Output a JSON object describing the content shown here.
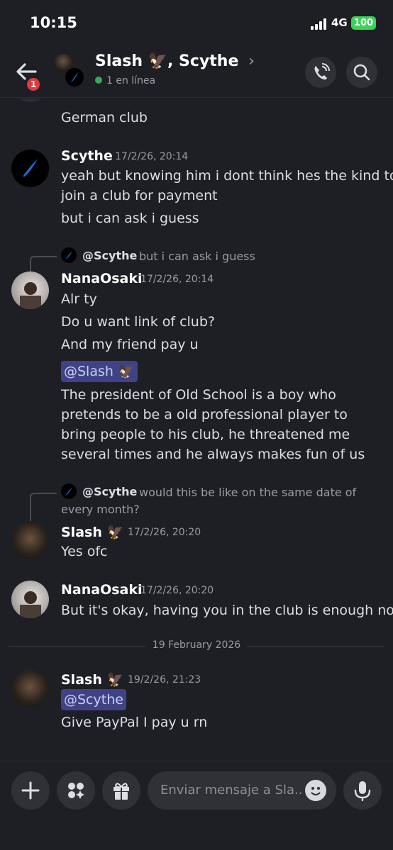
{
  "status_bar": {
    "time": "10:15",
    "network": "4G",
    "battery": "100"
  },
  "header": {
    "back_badge": "1",
    "title": "Slash 🦅, Scythe",
    "chevron": "›",
    "online": "1 en línea",
    "call_icon": "phone-icon",
    "search_icon": "search-icon"
  },
  "messages": {
    "partial_top": "German club",
    "m1": {
      "author": "Scythe",
      "time": "17/2/26, 20:14",
      "lines": [
        "yeah but knowing him i dont think hes the kind to",
        "join a club for payment",
        "but i can ask i guess"
      ]
    },
    "m2": {
      "reply_author": "@Scythe",
      "reply_text": "but i can ask i guess",
      "author": "NanaOsaki",
      "time": "17/2/26, 20:14",
      "lines": [
        "Alr ty",
        "Do u want link of club?",
        "And my friend pay u"
      ],
      "mention": "@Slash 🦅",
      "paragraph": "The president of Old School is a boy who pretends to be a old professional player to bring people to his club, he threatened me several times and he always makes fun of us"
    },
    "m3": {
      "reply_author": "@Scythe",
      "reply_text": "would this be like on the same date of",
      "reply_text2": "every month?",
      "author": "Slash 🦅",
      "time": "17/2/26, 20:20",
      "lines": [
        "Yes ofc"
      ]
    },
    "m4": {
      "author": "NanaOsaki",
      "time": "17/2/26, 20:20",
      "lines": [
        "But it's okay, having you in the club is enough now"
      ]
    },
    "date_divider": "19 February 2026",
    "m5": {
      "author": "Slash 🦅",
      "time": "19/2/26, 21:23",
      "mention": "@Scythe",
      "lines": [
        "Give PayPal I pay u rn"
      ]
    }
  },
  "composer": {
    "placeholder": "Enviar mensaje a Sla..",
    "buttons": [
      "plus-icon",
      "apps-icon",
      "gift-icon",
      "emoji-icon",
      "microphone-icon"
    ]
  },
  "colors": {
    "accent_mention_bg": "#3f4385",
    "online": "#3ba55d",
    "badge": "#e03a3e",
    "battery": "#3bd15a"
  }
}
